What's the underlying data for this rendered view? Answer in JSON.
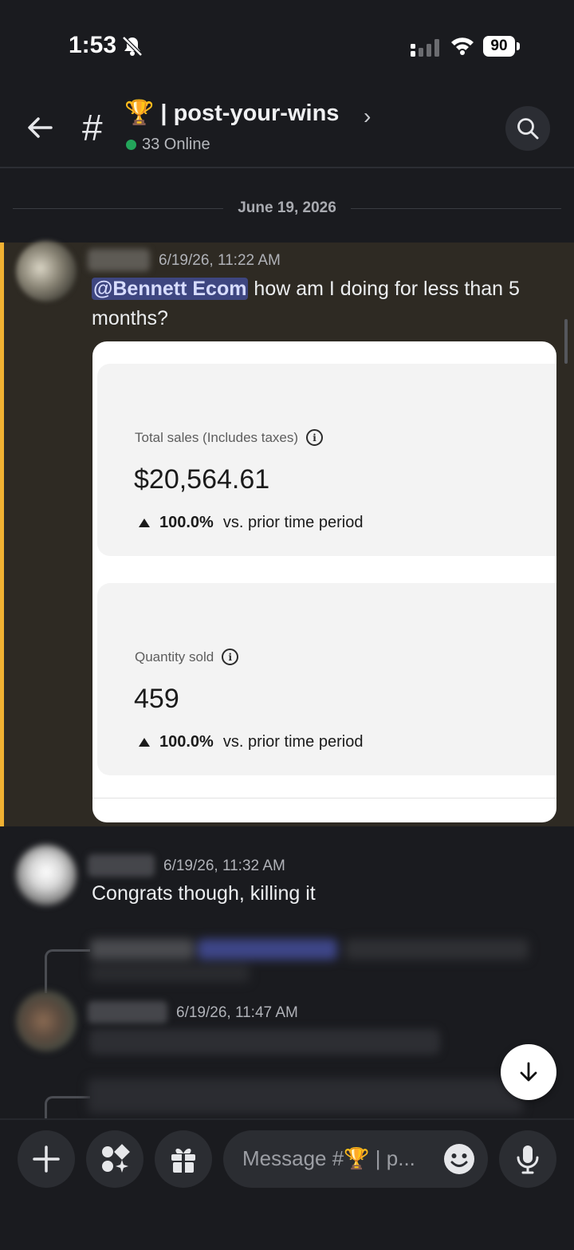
{
  "status_bar": {
    "time": "1:53",
    "battery": "90"
  },
  "header": {
    "hash": "#",
    "trophy": "🏆",
    "channel_name": "| post-your-wins",
    "chevron": "›",
    "online_text": "33 Online"
  },
  "date_divider": "June 19, 2026",
  "messages": [
    {
      "timestamp": "6/19/26, 11:22 AM",
      "mention": "@Bennett Ecom",
      "text": " how am I doing for less than 5 months?",
      "attachment": {
        "cards": [
          {
            "label": "Total sales (Includes taxes)",
            "value": "$20,564.61",
            "delta": "100.0%",
            "delta_suffix": "vs. prior time period"
          },
          {
            "label": "Quantity sold",
            "value": "459",
            "delta": "100.0%",
            "delta_suffix": "vs. prior time period"
          }
        ]
      }
    },
    {
      "timestamp": "6/19/26, 11:32 AM",
      "text": "Congrats though, killing it"
    },
    {
      "timestamp": "6/19/26, 11:47 AM"
    }
  ],
  "composer": {
    "placeholder": "Message #🏆 | p..."
  },
  "colors": {
    "highlight_bar": "#f0b132",
    "mention_bg": "#3e4680",
    "online_dot": "#23a55a"
  }
}
